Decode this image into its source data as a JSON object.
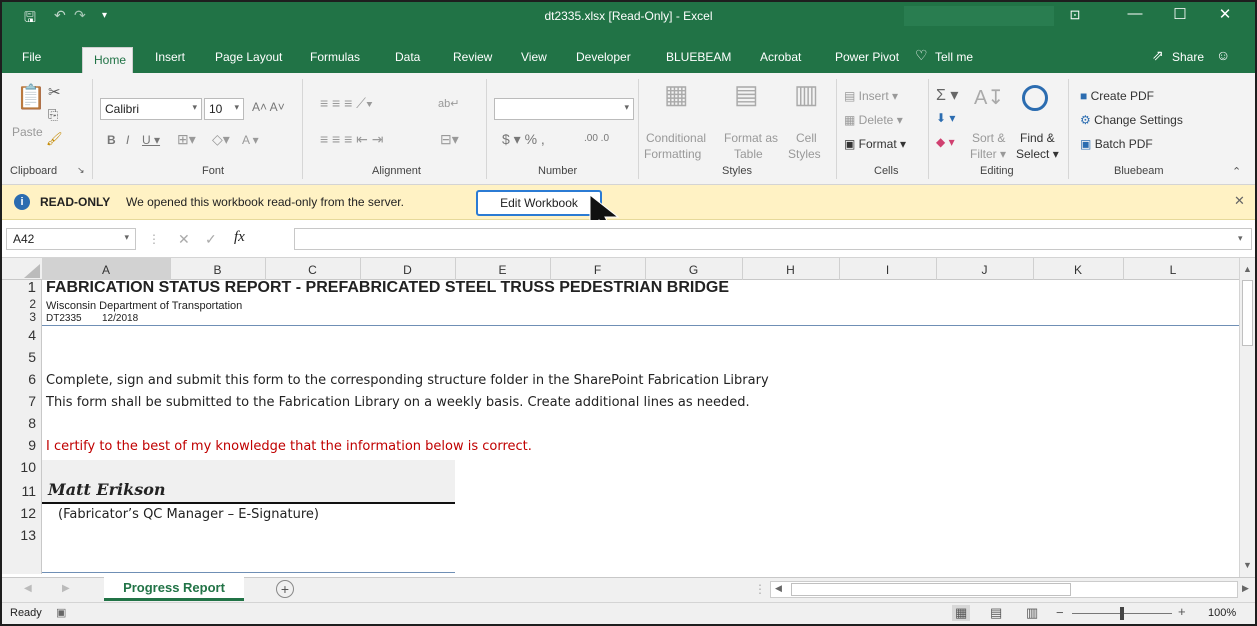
{
  "window": {
    "title": "dt2335.xlsx  [Read-Only]  -  Excel",
    "icons": [
      "save-icon",
      "undo-icon",
      "redo-icon",
      "customize-qat-icon",
      "ribbon-display-icon",
      "minimize-icon",
      "maximize-icon",
      "close-icon"
    ]
  },
  "menu": {
    "tabs": [
      "File",
      "Home",
      "Insert",
      "Page Layout",
      "Formulas",
      "Data",
      "Review",
      "View",
      "Developer",
      "BLUEBEAM",
      "Acrobat",
      "Power Pivot"
    ],
    "tell_me": "Tell me",
    "share": "Share"
  },
  "ribbon": {
    "clipboard": {
      "paste": "Paste",
      "group": "Clipboard"
    },
    "font": {
      "name": "Calibri",
      "size": "10",
      "group": "Font"
    },
    "alignment": {
      "group": "Alignment"
    },
    "number": {
      "format": "",
      "group": "Number"
    },
    "styles": {
      "conditional": "Conditional",
      "formatting": "Formatting",
      "format_as": "Format as",
      "table": "Table",
      "cell": "Cell",
      "styles": "Styles",
      "group": "Styles"
    },
    "cells": {
      "insert": "Insert",
      "delete": "Delete",
      "format": "Format",
      "group": "Cells"
    },
    "editing": {
      "sort": "Sort &",
      "filter": "Filter",
      "find": "Find &",
      "select": "Select",
      "group": "Editing"
    },
    "bluebeam": {
      "create_pdf": "Create PDF",
      "change_settings": "Change Settings",
      "batch_pdf": "Batch PDF",
      "group": "Bluebeam"
    }
  },
  "infobar": {
    "label": "READ-ONLY",
    "message": "We opened this workbook read-only from the server.",
    "button": "Edit Workbook"
  },
  "formula": {
    "name_box": "A42",
    "fx": "fx",
    "value": ""
  },
  "columns": [
    "A",
    "B",
    "C",
    "D",
    "E",
    "F",
    "G",
    "H",
    "I",
    "J",
    "K",
    "L"
  ],
  "rows": [
    "1",
    "2",
    "3",
    "4",
    "5",
    "6",
    "7",
    "8",
    "9",
    "10",
    "11",
    "12",
    "13"
  ],
  "cells": {
    "r1": "FABRICATION STATUS REPORT - PREFABRICATED STEEL TRUSS PEDESTRIAN BRIDGE",
    "r2": "Wisconsin Department of Transportation",
    "r3a": "DT2335",
    "r3b": "12/2018",
    "r5": "Complete, sign and submit this form to the corresponding structure folder in the SharePoint Fabrication Library",
    "r6": "This form shall be submitted to the Fabrication Library on a weekly basis.  Create additional lines as needed.",
    "r8": "I certify to the best of my knowledge that the information below is correct.",
    "r10": "Matt Erikson",
    "r11": "(Fabricator’s QC Manager – E-Signature)"
  },
  "sheets": {
    "active": "Progress Report",
    "add": "+"
  },
  "status": {
    "ready": "Ready",
    "zoom": "100%"
  },
  "colors": {
    "excel_green": "#217346",
    "info_yellow": "#fff2c4",
    "red_text": "#c00000",
    "focus_blue": "#2b7bd4"
  }
}
